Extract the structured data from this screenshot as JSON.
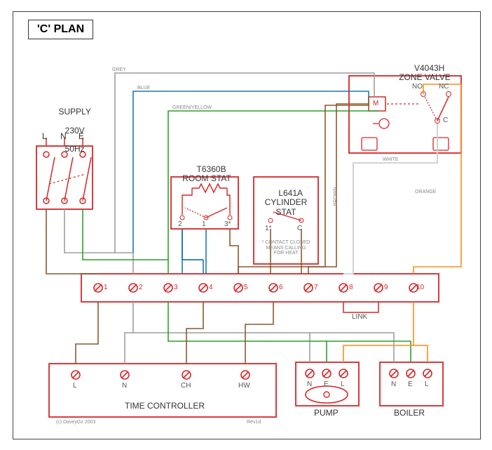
{
  "title": "'C' PLAN",
  "supply": {
    "label": "SUPPLY",
    "voltage": "230V",
    "freq": "50Hz",
    "terminals": [
      "L",
      "N",
      "E"
    ]
  },
  "room_stat": {
    "model": "T6360B",
    "name": "ROOM STAT",
    "terminals": [
      "2",
      "1",
      "3*"
    ]
  },
  "cyl_stat": {
    "model": "L641A",
    "name": "CYLINDER\nSTAT",
    "terminals": [
      "1*",
      "C"
    ],
    "note": "* CONTACT CLOSED\nMEANS CALLING\nFOR HEAT"
  },
  "zone_valve": {
    "model": "V4043H",
    "name": "ZONE VALVE",
    "motor": "M",
    "no": "NO",
    "nc": "NC",
    "c": "C"
  },
  "junction": {
    "terminals": [
      "1",
      "2",
      "3",
      "4",
      "5",
      "6",
      "7",
      "8",
      "9",
      "10"
    ],
    "link_label": "LINK"
  },
  "time_controller": {
    "name": "TIME CONTROLLER",
    "terminals": [
      "L",
      "N",
      "CH",
      "HW"
    ]
  },
  "pump": {
    "name": "PUMP",
    "terminals": [
      "N",
      "E",
      "L"
    ]
  },
  "boiler": {
    "name": "BOILER",
    "terminals": [
      "N",
      "E",
      "L"
    ]
  },
  "wires": {
    "grey": "GREY",
    "blue": "BLUE",
    "green_yellow": "GREEN/YELLOW",
    "brown": "BROWN",
    "white": "WHITE",
    "orange": "ORANGE"
  },
  "footnote_left": "(c) DaveyGz 2003",
  "footnote_right": "Rev1d"
}
